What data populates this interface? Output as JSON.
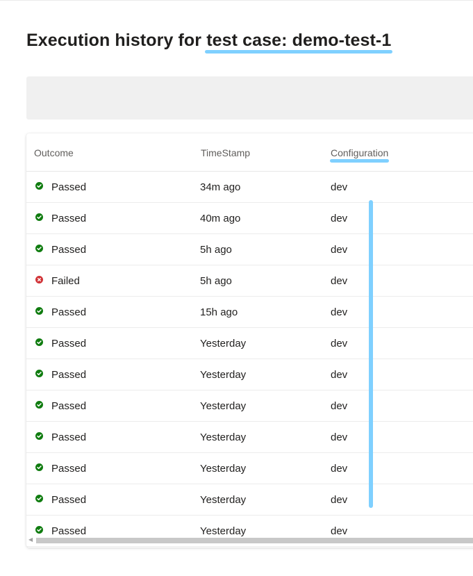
{
  "title": {
    "prefix": "Execution history for ",
    "highlight": "test case: demo-test-1"
  },
  "table": {
    "columns": {
      "outcome": "Outcome",
      "timestamp": "TimeStamp",
      "configuration": "Configuration"
    },
    "rows": [
      {
        "outcome": "Passed",
        "status": "passed",
        "timestamp": "34m ago",
        "configuration": "dev"
      },
      {
        "outcome": "Passed",
        "status": "passed",
        "timestamp": "40m ago",
        "configuration": "dev"
      },
      {
        "outcome": "Passed",
        "status": "passed",
        "timestamp": "5h ago",
        "configuration": "dev"
      },
      {
        "outcome": "Failed",
        "status": "failed",
        "timestamp": "5h ago",
        "configuration": "dev"
      },
      {
        "outcome": "Passed",
        "status": "passed",
        "timestamp": "15h ago",
        "configuration": "dev"
      },
      {
        "outcome": "Passed",
        "status": "passed",
        "timestamp": "Yesterday",
        "configuration": "dev"
      },
      {
        "outcome": "Passed",
        "status": "passed",
        "timestamp": "Yesterday",
        "configuration": "dev"
      },
      {
        "outcome": "Passed",
        "status": "passed",
        "timestamp": "Yesterday",
        "configuration": "dev"
      },
      {
        "outcome": "Passed",
        "status": "passed",
        "timestamp": "Yesterday",
        "configuration": "dev"
      },
      {
        "outcome": "Passed",
        "status": "passed",
        "timestamp": "Yesterday",
        "configuration": "dev"
      },
      {
        "outcome": "Passed",
        "status": "passed",
        "timestamp": "Yesterday",
        "configuration": "dev"
      },
      {
        "outcome": "Passed",
        "status": "passed",
        "timestamp": "Yesterday",
        "configuration": "dev"
      }
    ]
  },
  "icons": {
    "passed": "check-circle-icon",
    "failed": "error-circle-icon",
    "scroll_left": "caret-left-icon"
  },
  "colors": {
    "passed": "#107c10",
    "failed": "#d13438",
    "highlight": "#7fd0ff",
    "filter_bar": "#f0f0f0"
  }
}
